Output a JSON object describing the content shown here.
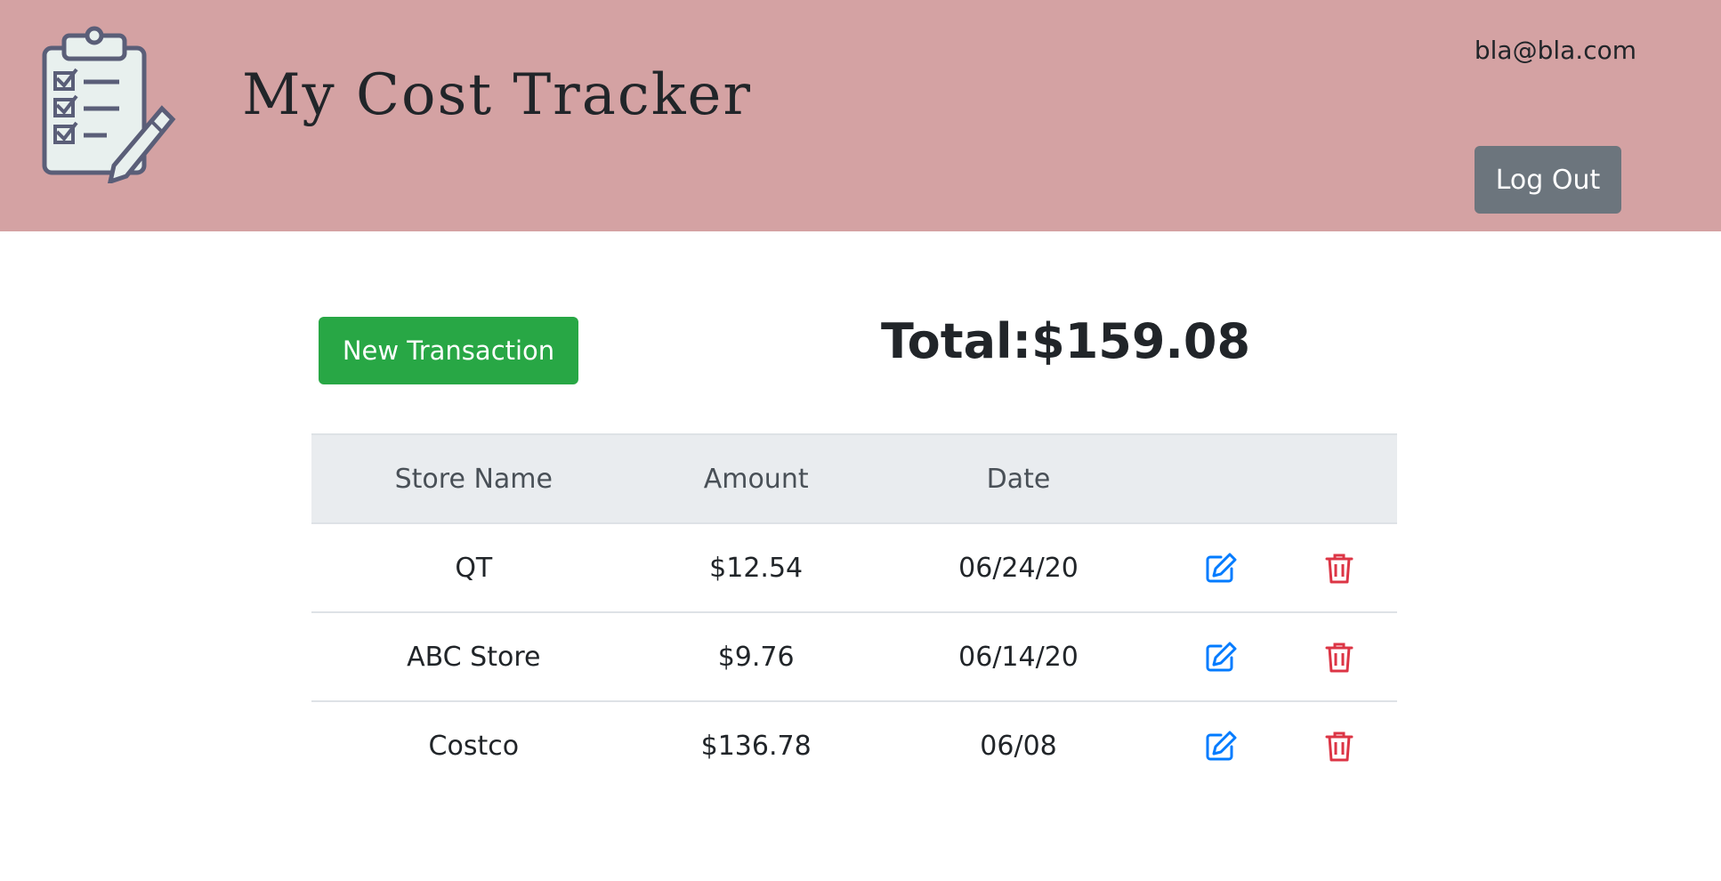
{
  "header": {
    "title": "My Cost Tracker",
    "user_email": "bla@bla.com",
    "logout_label": "Log Out",
    "logo_icon": "clipboard-checklist-pencil-icon"
  },
  "actions": {
    "new_transaction_label": "New Transaction"
  },
  "total": {
    "label": "Total:$159.08"
  },
  "table": {
    "columns": [
      "Store Name",
      "Amount",
      "Date",
      "",
      ""
    ],
    "rows": [
      {
        "store": "QT",
        "amount": "$12.54",
        "date": "06/24/20",
        "edit_icon": "edit-icon",
        "delete_icon": "trash-icon"
      },
      {
        "store": "ABC Store",
        "amount": "$9.76",
        "date": "06/14/20",
        "edit_icon": "edit-icon",
        "delete_icon": "trash-icon"
      },
      {
        "store": "Costco",
        "amount": "$136.78",
        "date": "06/08",
        "edit_icon": "edit-icon",
        "delete_icon": "trash-icon"
      }
    ]
  },
  "colors": {
    "header_bg": "#d4a2a3",
    "logout_bg": "#6c757d",
    "new_tx_bg": "#28a745",
    "table_head_bg": "#e9ecef",
    "edit_icon": "#007bff",
    "delete_icon": "#dc3545"
  }
}
